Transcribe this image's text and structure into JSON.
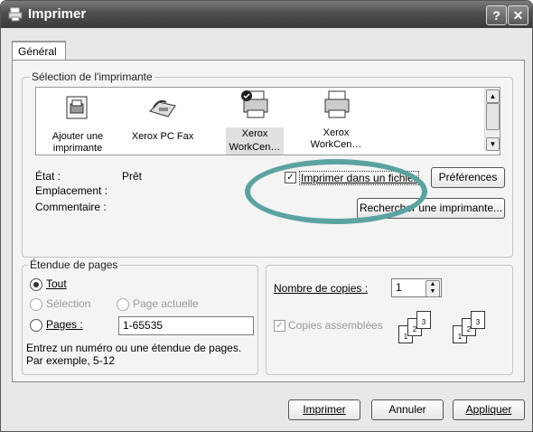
{
  "window": {
    "title": "Imprimer",
    "help_label": "?",
    "close_label": "✕"
  },
  "tabs": [
    {
      "label": "Général"
    }
  ],
  "printer_selection": {
    "legend": "Sélection de l'imprimante",
    "printers": [
      {
        "label_line1": "Ajouter une",
        "label_line2": "imprimante",
        "icon": "add-printer-icon"
      },
      {
        "label_line1": "Xerox PC Fax",
        "label_line2": "",
        "icon": "fax-icon"
      },
      {
        "label_line1": "Xerox",
        "label_line2": "WorkCen…",
        "icon": "printer-default-icon"
      },
      {
        "label_line1": "Xerox",
        "label_line2": "WorkCen…",
        "icon": "printer-icon"
      }
    ],
    "scroll_up": "▲",
    "scroll_down": "▼",
    "status_label": "État :",
    "status_value": "Prêt",
    "location_label": "Emplacement :",
    "location_value": "",
    "comment_label": "Commentaire :",
    "comment_value": "",
    "print_to_file": {
      "label": "Imprimer dans un fichier",
      "checked": true
    },
    "preferences_button": "Préférences",
    "find_printer_button": "Rechercher une imprimante..."
  },
  "page_range": {
    "legend": "Étendue de pages",
    "all_label": "Tout",
    "selection_label": "Sélection",
    "current_page_label": "Page actuelle",
    "pages_label": "Pages :",
    "pages_value": "1-65535",
    "hint_line1": "Entrez un numéro ou une étendue de pages.",
    "hint_line2": "Par exemple, 5-12",
    "selected": "Tout"
  },
  "copies": {
    "label": "Nombre de copies :",
    "value": "1",
    "collate_label": "Copies assemblées",
    "collate_checked": true,
    "page_numbers": [
      "1",
      "2",
      "3"
    ]
  },
  "footer": {
    "print_button": "Imprimer",
    "cancel_button": "Annuler",
    "apply_button": "Appliquer"
  },
  "colors": {
    "highlight_oval": "#5aa3a1",
    "titlebar": "#4e4e4e"
  }
}
